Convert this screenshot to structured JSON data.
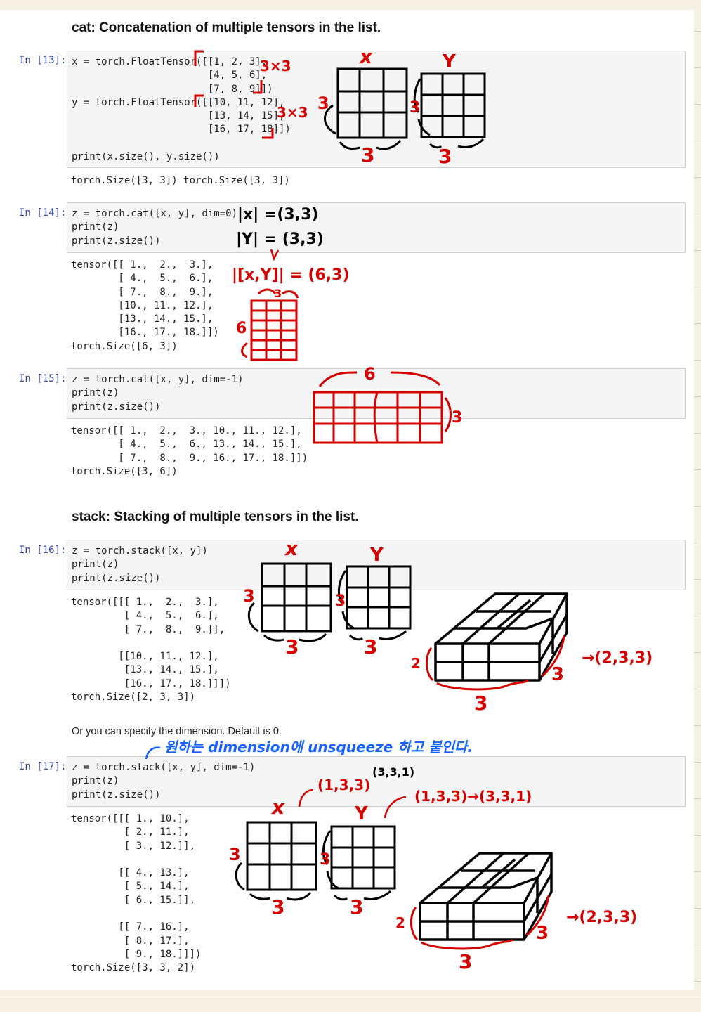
{
  "headings": {
    "cat": "cat: Concatenation of multiple tensors in the list.",
    "stack": "stack: Stacking of multiple tensors in the list."
  },
  "note_text": "Or you can specify the dimension. Default is 0.",
  "cells": [
    {
      "prompt": "In [13]:",
      "code": [
        "x = torch.FloatTensor([[1, 2, 3],",
        "                       [4, 5, 6],",
        "                       [7, 8, 9]])",
        "y = torch.FloatTensor([[10, 11, 12],",
        "                       [13, 14, 15],",
        "                       [16, 17, 18]])",
        "",
        "print(x.size(), y.size())"
      ],
      "output": [
        "torch.Size([3, 3]) torch.Size([3, 3])"
      ]
    },
    {
      "prompt": "In [14]:",
      "code": [
        "z = torch.cat([x, y], dim=0)",
        "print(z)",
        "print(z.size())"
      ],
      "output": [
        "tensor([[ 1.,  2.,  3.],",
        "        [ 4.,  5.,  6.],",
        "        [ 7.,  8.,  9.],",
        "        [10., 11., 12.],",
        "        [13., 14., 15.],",
        "        [16., 17., 18.]])",
        "torch.Size([6, 3])"
      ]
    },
    {
      "prompt": "In [15]:",
      "code": [
        "z = torch.cat([x, y], dim=-1)",
        "print(z)",
        "print(z.size())"
      ],
      "output": [
        "tensor([[ 1.,  2.,  3., 10., 11., 12.],",
        "        [ 4.,  5.,  6., 13., 14., 15.],",
        "        [ 7.,  8.,  9., 16., 17., 18.]])",
        "torch.Size([3, 6])"
      ]
    },
    {
      "prompt": "In [16]:",
      "code": [
        "z = torch.stack([x, y])",
        "print(z)",
        "print(z.size())"
      ],
      "output": [
        "tensor([[[ 1.,  2.,  3.],",
        "         [ 4.,  5.,  6.],",
        "         [ 7.,  8.,  9.]],",
        "",
        "        [[10., 11., 12.],",
        "         [13., 14., 15.],",
        "         [16., 17., 18.]]])",
        "torch.Size([2, 3, 3])"
      ]
    },
    {
      "prompt": "In [17]:",
      "code": [
        "z = torch.stack([x, y], dim=-1)",
        "print(z)",
        "print(z.size())"
      ],
      "output": [
        "tensor([[[ 1., 10.],",
        "         [ 2., 11.],",
        "         [ 3., 12.]],",
        "",
        "        [[ 4., 13.],",
        "         [ 5., 14.],",
        "         [ 6., 15.]],",
        "",
        "        [[ 7., 16.],",
        "         [ 8., 17.],",
        "         [ 9., 18.]]])",
        "torch.Size([3, 3, 2])"
      ]
    }
  ],
  "annotations": {
    "three_by_three": "3×3",
    "x": "x",
    "y": "Y",
    "three": "3",
    "two": "2",
    "six": "6",
    "x_size": "|x| =(3,3)",
    "y_size": "|Y| = (3,3)",
    "cat_size": "|[x,Y]| = (6,3)",
    "shape_233": "→(2,3,3)",
    "shape_133": "(1,3,3)",
    "shape_331": "(3,3,1)",
    "shape_133_331": "(1,3,3)→(3,3,1)",
    "korean_note": "원하는 dimension에 unsqueeze 하고 붙인다."
  },
  "colors": {
    "code_green": "#008000",
    "prompt_blue": "#303f9f",
    "ink_red": "#d40000",
    "ink_black": "#000000",
    "ink_blue": "#1560ff",
    "highlight": "#ffe94d"
  }
}
